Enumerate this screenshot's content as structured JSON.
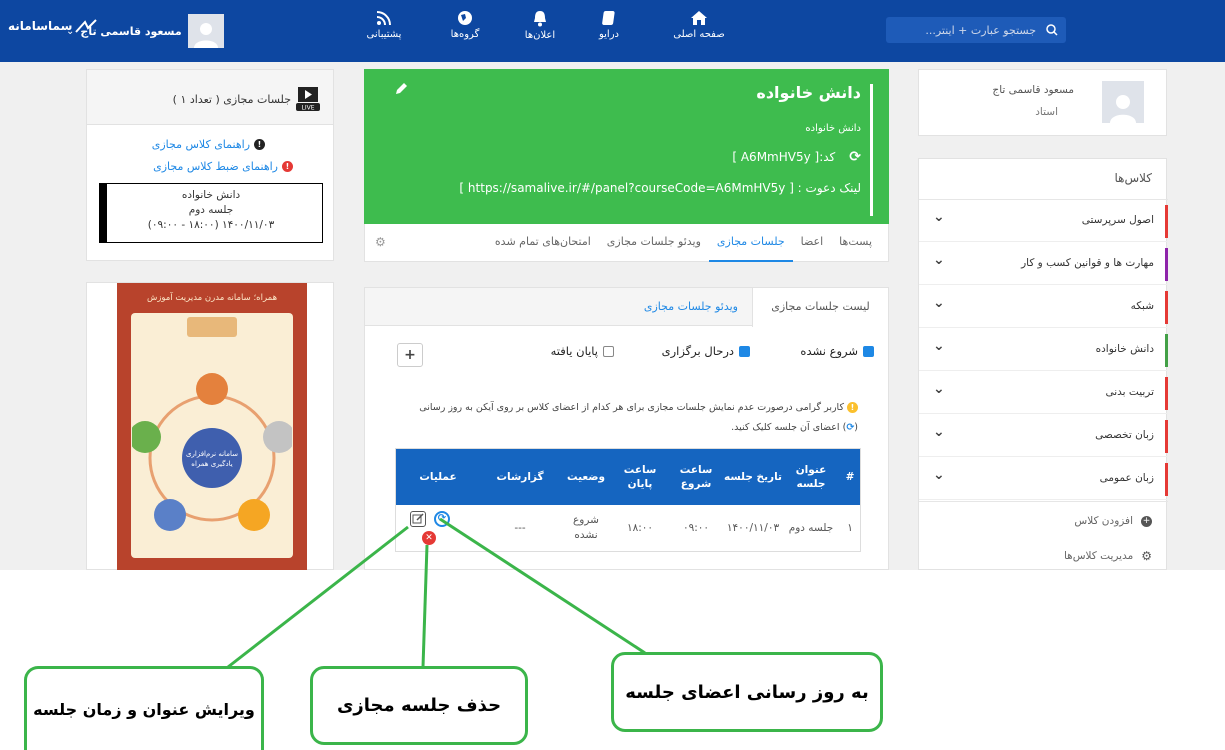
{
  "navbar": {
    "search_placeholder": "جستجو عبارت + اینتر...",
    "user_name": "مسعود قاسمی تاج",
    "items": [
      {
        "label": "صفحه اصلی",
        "icon": "home-icon"
      },
      {
        "label": "درایو",
        "icon": "drive-icon"
      },
      {
        "label": "اعلان‌ها",
        "icon": "bell-icon"
      },
      {
        "label": "گروه‌ها",
        "icon": "globe-icon"
      },
      {
        "label": "پشتیبانی",
        "icon": "rss-icon"
      }
    ]
  },
  "profile": {
    "name": "مسعود قاسمی تاج",
    "role": "استاد"
  },
  "classes": {
    "title": "کلاس‌ها",
    "items": [
      {
        "label": "اصول سرپرستی",
        "color": "#e53935"
      },
      {
        "label": "مهارت ها و قوانین کسب و کار",
        "color": "#8e24aa"
      },
      {
        "label": "شبکه",
        "color": "#e53935"
      },
      {
        "label": "دانش خانواده",
        "color": "#43a047"
      },
      {
        "label": "تربیت بدنی",
        "color": "#e53935"
      },
      {
        "label": "زبان تخصصی",
        "color": "#e53935"
      },
      {
        "label": "زبان عمومی",
        "color": "#e53935"
      }
    ],
    "add_class": "افزودن کلاس",
    "manage_classes": "مدیریت کلاس‌ها"
  },
  "course": {
    "title": "دانش خانواده",
    "subtitle": "دانش خانواده",
    "code": "کد:[ A6MmHV5y ]",
    "invite": "لینک دعوت : [ https://samalive.ir/#/panel?courseCode=A6MmHV5y ]",
    "tabs": [
      "پست‌ها",
      "اعضا",
      "جلسات مجازی",
      "ویدئو جلسات مجازی",
      "امتحان‌های تمام شده"
    ]
  },
  "sessions": {
    "subtabs": [
      "لیست جلسات مجازی",
      "ویدئو جلسات مجازی"
    ],
    "filters": {
      "not_started": "شروع نشده",
      "in_progress": "درحال برگزاری",
      "finished": "پایان یافته"
    },
    "add_symbol": "+",
    "notice": "کاربر گرامی درصورت عدم نمایش جلسات مجازی برای هر کدام از اعضای کلاس بر روی آیکن به روز رسانی",
    "notice2": "اعضای آن جلسه کلیک کنید.",
    "columns": [
      "#",
      "عنوان جلسه",
      "تاریخ جلسه",
      "ساعت شروع",
      "ساعت پایان",
      "وضعیت",
      "گزارشات",
      "عملیات"
    ],
    "rows": [
      {
        "num": "۱",
        "title": "جلسه دوم",
        "date": "۱۴۰۰/۱۱/۰۳",
        "start": "۰۹:۰۰",
        "end": "۱۸:۰۰",
        "status": "شروع نشده",
        "reports": "---"
      }
    ]
  },
  "virtual": {
    "title": "جلسات مجازی ( تعداد ۱ )",
    "guide1": "راهنمای کلاس مجازی",
    "guide2": "راهنمای ضبط کلاس مجازی",
    "session_course": "دانش خانواده",
    "session_name": "جلسه دوم",
    "session_time": "۱۴۰۰/۱۱/۰۳ (۱۸:۰۰ - ۰۹:۰۰)"
  },
  "banner": {
    "title": "همراه؛ سامانه مدرن مدیریت آموزش",
    "center": "سامانه نرم‌افزاری یادگیری همراه"
  },
  "callouts": {
    "edit": "ویرایش عنوان و زمان جلسه",
    "delete": "حذف جلسه مجازی",
    "refresh": "به روز رسانی اعضای جلسه"
  }
}
